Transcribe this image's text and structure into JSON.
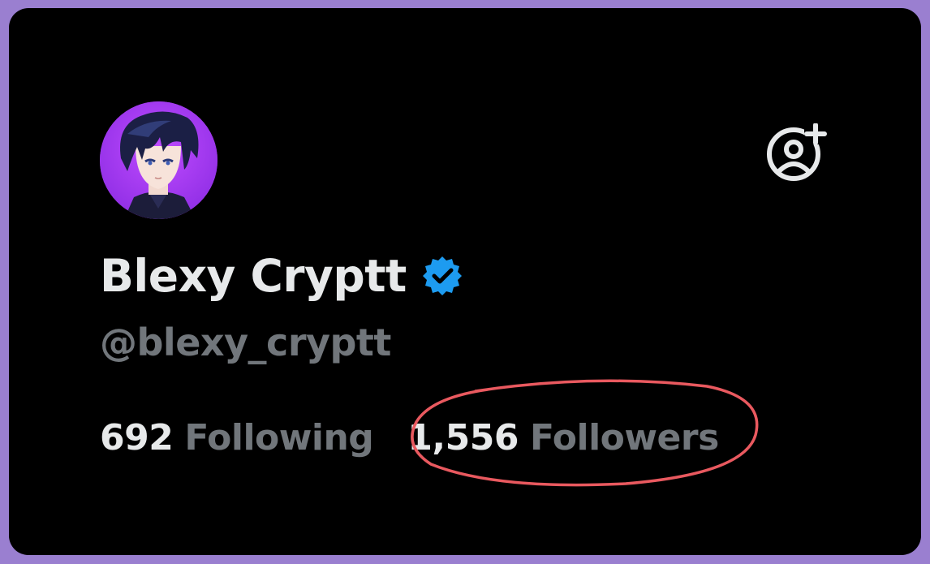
{
  "profile": {
    "display_name": "Blexy Cryptt",
    "handle": "@blexy_cryptt",
    "verified": true,
    "avatar": "anime-character-avatar"
  },
  "stats": {
    "following_count": "692",
    "following_label": "Following",
    "followers_count": "1,556",
    "followers_label": "Followers"
  },
  "actions": {
    "follow_icon": "add-user-icon"
  },
  "annotation": {
    "shape": "ellipse-highlight",
    "target": "followers",
    "color": "#e9595f"
  },
  "colors": {
    "frame": "#9a7fd0",
    "card_bg": "#000000",
    "primary_text": "#e7e9ea",
    "secondary_text": "#71767b",
    "verified_blue": "#1d9bf0",
    "avatar_bg": "#a33cf0"
  }
}
